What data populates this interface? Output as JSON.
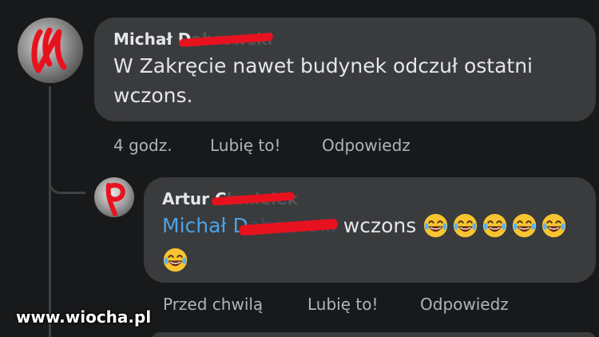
{
  "comment": {
    "author_name": "Michał D",
    "author_redacted_suffix": "abrowski",
    "text": "W Zakręcie nawet budynek odczuł ostatni wczons.",
    "time": "4 godz.",
    "like_label": "Lubię to!",
    "reply_label": "Odpowiedz"
  },
  "reply": {
    "author_name": "Artur C",
    "author_redacted_suffix": "hmielek",
    "mention": "Michał D",
    "mention_redacted_suffix": "abrowski",
    "text": "wczons",
    "emoji": [
      "face-with-tears-of-joy",
      "face-with-tears-of-joy",
      "face-with-tears-of-joy",
      "face-with-tears-of-joy",
      "face-with-tears-of-joy",
      "face-with-tears-of-joy"
    ],
    "time": "Przed chwilą",
    "like_label": "Lubię to!",
    "reply_label": "Odpowiedz"
  },
  "watermark": "www.wiocha.pl",
  "colors": {
    "background": "#18191a",
    "bubble": "#3a3b3c",
    "text": "#e4e6eb",
    "muted": "#b0b3b8",
    "mention": "#4aa3e8",
    "redaction": "#e8121f"
  }
}
